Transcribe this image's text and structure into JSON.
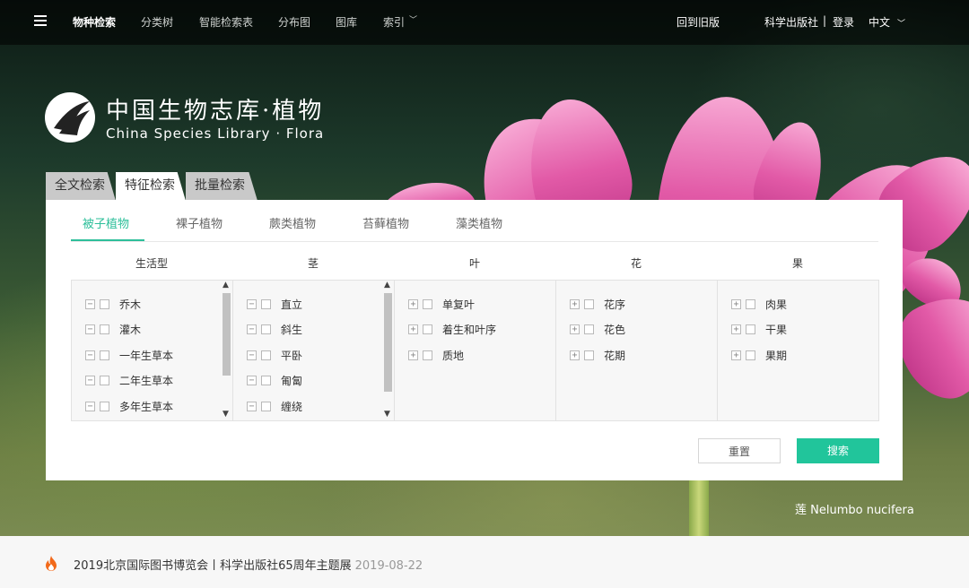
{
  "nav": {
    "items": [
      "物种检索",
      "分类树",
      "智能检索表",
      "分布图",
      "图库",
      "索引"
    ],
    "right": {
      "old_version": "回到旧版",
      "publisher": "科学出版社",
      "separator": "|",
      "login": "登录",
      "language": "中文"
    }
  },
  "logo": {
    "cn_title": "中国生物志库·植物",
    "en_title": "China Species Library ·  Flora"
  },
  "search_tabs": [
    "全文检索",
    "特征检索",
    "批量检索"
  ],
  "plant_tabs": [
    "被子植物",
    "裸子植物",
    "蕨类植物",
    "苔藓植物",
    "藻类植物"
  ],
  "columns": [
    {
      "title": "生活型",
      "items": [
        "乔木",
        "灌木",
        "一年生草本",
        "二年生草本",
        "多年生草本"
      ],
      "toggle": "−"
    },
    {
      "title": "茎",
      "items": [
        "直立",
        "斜生",
        "平卧",
        "匍匐",
        "缠绕"
      ],
      "toggle": "−"
    },
    {
      "title": "叶",
      "items": [
        "单复叶",
        "着生和叶序",
        "质地"
      ],
      "toggle": "+"
    },
    {
      "title": "花",
      "items": [
        "花序",
        "花色",
        "花期"
      ],
      "toggle": "+"
    },
    {
      "title": "果",
      "items": [
        "肉果",
        "干果",
        "果期"
      ],
      "toggle": "+"
    }
  ],
  "buttons": {
    "reset": "重置",
    "search": "搜索"
  },
  "caption": "莲 Nelumbo nucifera",
  "news": {
    "text": "2019北京国际图书博览会丨科学出版社65周年主题展",
    "date": "2019-08-22"
  },
  "colors": {
    "accent": "#21c59b",
    "tab_active": "#2dbf9a"
  }
}
